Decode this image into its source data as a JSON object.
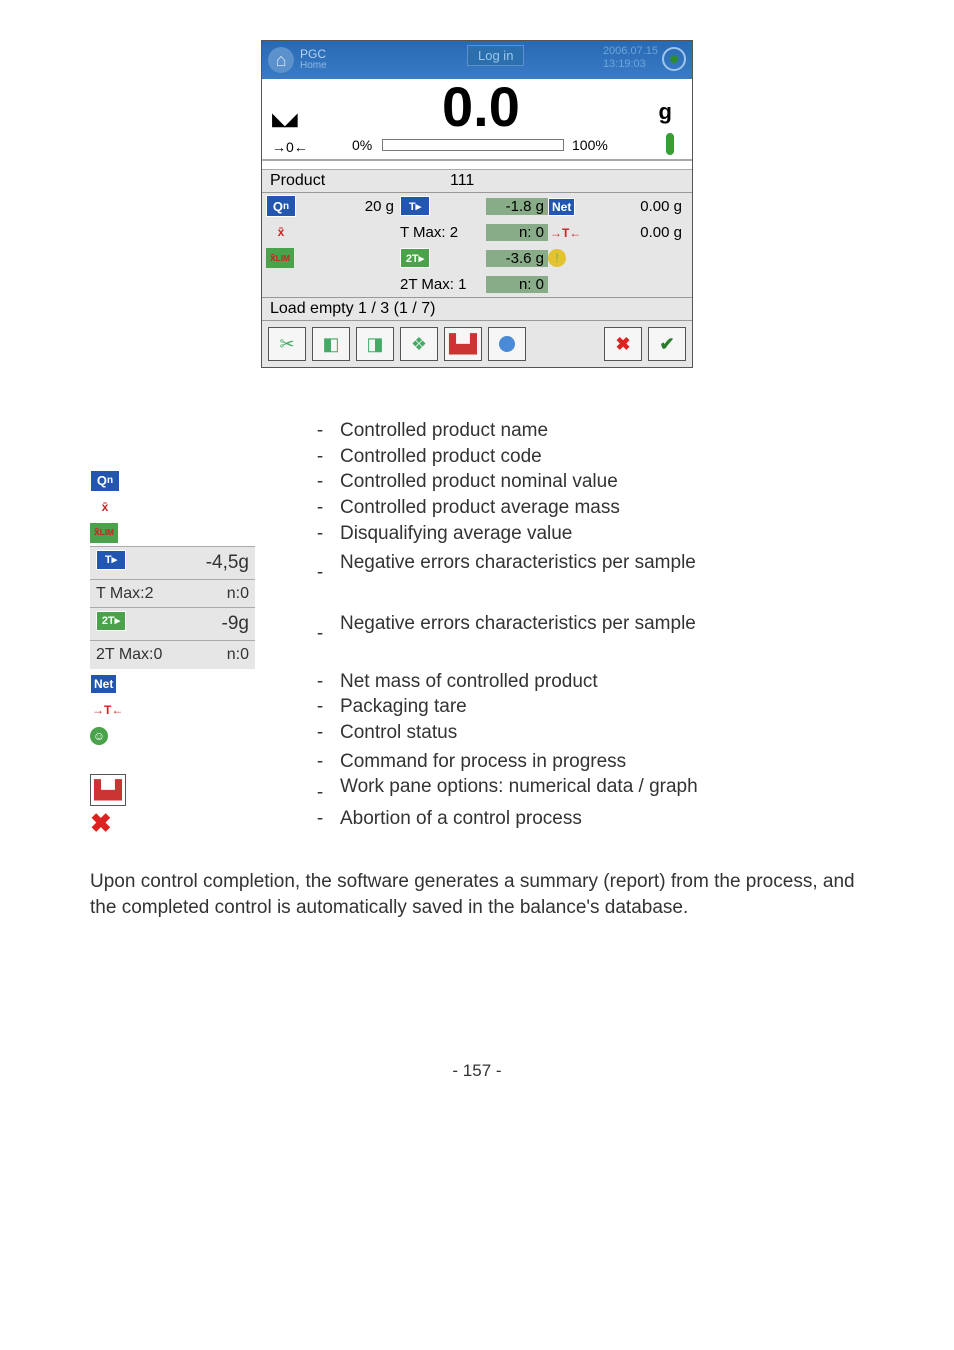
{
  "screenshot": {
    "header": {
      "mode": "PGC",
      "home": "Home",
      "login": "Log in",
      "date": "2006.07.15",
      "time": "13:19:03"
    },
    "readout": {
      "value": "0.0",
      "unit": "g",
      "zero_marker": "→0←",
      "pct_left": "0%",
      "pct_right": "100%"
    },
    "product": {
      "label": "Product",
      "code": "111"
    },
    "data": {
      "qn_val": "20 g",
      "t_icon": "T to",
      "t_val": "-1.8 g",
      "net_label": "Net",
      "net_far": "0.00 g",
      "tmax_label": "T Max: 2",
      "tmax_n": "n: 0",
      "tplus": "→T←",
      "tplus_far": "0.00 g",
      "tt_icon": "2T to",
      "tt_val": "-3.6 g",
      "ball": "☺",
      "tt_max_label": "2T Max: 1",
      "tt_max_n": "n: 0"
    },
    "load_line": "Load empty 1 / 3 (1 / 7)"
  },
  "legend": {
    "items_a": [
      "Controlled product name",
      "Controlled product code",
      "Controlled product nominal value",
      "Controlled product average mass",
      "Disqualifying average value"
    ],
    "box1": {
      "line1_val": "-4,5g",
      "line2_label": "T Max:2",
      "line2_val": "n:0"
    },
    "box1_desc": "Negative errors characteristics per sample",
    "box2": {
      "line1_val": "-9g",
      "line2_label": "2T Max:0",
      "line2_val": "n:0"
    },
    "box2_desc": "Negative errors characteristics per sample",
    "items_b": [
      "Net mass of controlled product",
      "Packaging tare",
      "Control status"
    ],
    "item_c": "Command for process in progress",
    "item_d": "Work pane options: numerical data / graph",
    "item_e": "Abortion of a control process"
  },
  "paragraph": "Upon control completion, the software generates a summary (report) from the process, and the completed control is automatically saved in the balance's database.",
  "footer": "- 157 -"
}
